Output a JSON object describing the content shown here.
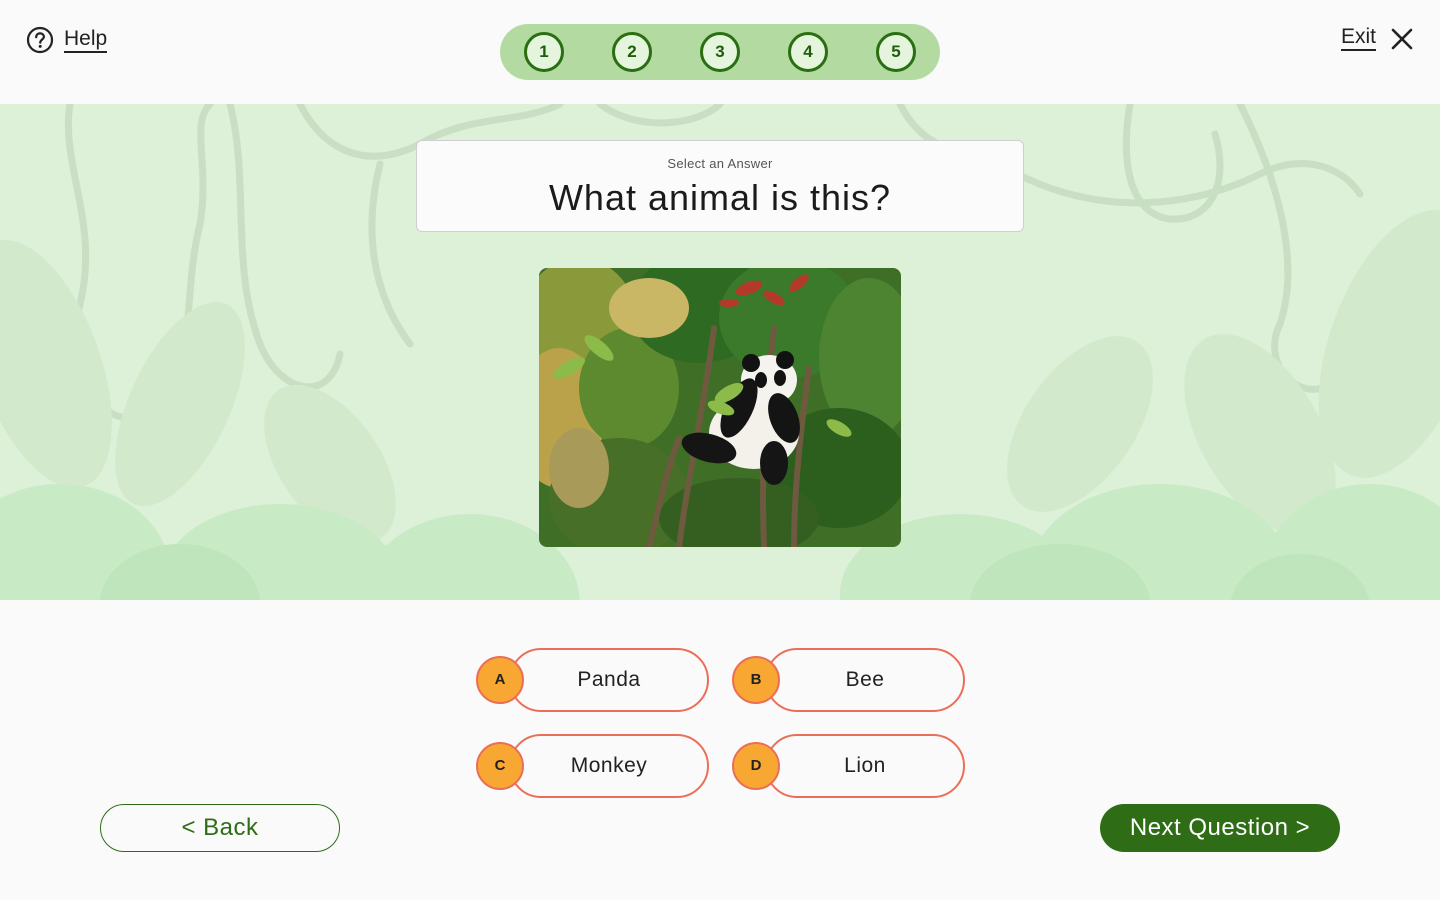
{
  "header": {
    "help_label": "Help",
    "exit_label": "Exit",
    "steps": [
      "1",
      "2",
      "3",
      "4",
      "5"
    ]
  },
  "question": {
    "instruction": "Select an Answer",
    "text": "What animal is this?"
  },
  "answers": [
    {
      "letter": "A",
      "label": "Panda"
    },
    {
      "letter": "B",
      "label": "Bee"
    },
    {
      "letter": "C",
      "label": "Monkey"
    },
    {
      "letter": "D",
      "label": "Lion"
    }
  ],
  "nav": {
    "back_label": "< Back",
    "next_label": "Next Question >"
  },
  "colors": {
    "primary_green": "#2e6d16",
    "progress_track": "#b3dba1",
    "answer_border": "#ea6f58",
    "answer_badge": "#f9a733",
    "hero_bg": "#ddf0d8"
  },
  "icons": {
    "help": "question-circle-icon",
    "exit": "close-icon"
  }
}
